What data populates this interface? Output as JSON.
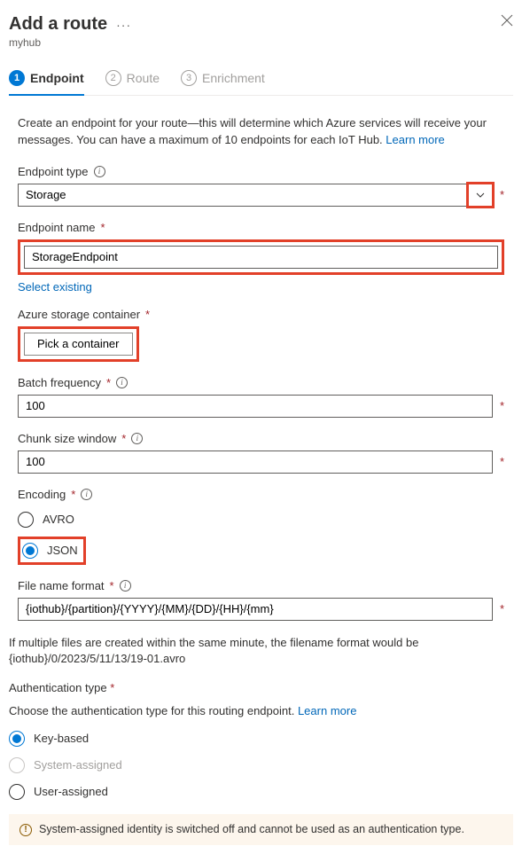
{
  "header": {
    "title": "Add a route",
    "subtitle": "myhub"
  },
  "tabs": {
    "endpoint": "Endpoint",
    "route": "Route",
    "enrichment": "Enrichment"
  },
  "intro": {
    "text": "Create an endpoint for your route—this will determine which Azure services will receive your messages. You can have a maximum of 10 endpoints for each IoT Hub. ",
    "learn_more": "Learn more"
  },
  "endpoint_type": {
    "label": "Endpoint type",
    "value": "Storage"
  },
  "endpoint_name": {
    "label": "Endpoint name",
    "value": "StorageEndpoint",
    "select_existing": "Select existing"
  },
  "storage_container": {
    "label": "Azure storage container",
    "button": "Pick a container"
  },
  "batch_frequency": {
    "label": "Batch frequency",
    "value": "100"
  },
  "chunk_size": {
    "label": "Chunk size window",
    "value": "100"
  },
  "encoding": {
    "label": "Encoding",
    "options": {
      "avro": "AVRO",
      "json": "JSON"
    },
    "selected": "json"
  },
  "file_format": {
    "label": "File name format",
    "value": "{iothub}/{partition}/{YYYY}/{MM}/{DD}/{HH}/{mm}",
    "note": "If multiple files are created within the same minute, the filename format would be {iothub}/0/2023/5/11/13/19-01.avro"
  },
  "auth": {
    "label": "Authentication type",
    "desc": "Choose the authentication type for this routing endpoint. ",
    "learn_more": "Learn more",
    "options": {
      "key": "Key-based",
      "system": "System-assigned",
      "user": "User-assigned"
    },
    "selected": "key"
  },
  "warning": "System-assigned identity is switched off and cannot be used as an authentication type."
}
